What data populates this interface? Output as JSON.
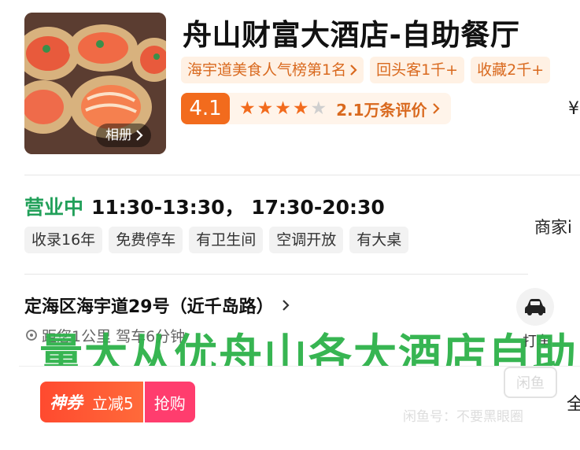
{
  "shop": {
    "title": "舟山财富大酒店-自助餐厅",
    "album_label": "相册",
    "tags": [
      "海宇道美食人气榜第1名",
      "回头客1千+",
      "收藏2千+"
    ],
    "rating": {
      "score": "4.1",
      "stars": 4,
      "max_stars": 5,
      "reviews_label": "2.1万条评价"
    },
    "price_partial": "¥"
  },
  "hours": {
    "status": "营业中",
    "text": "11:30-13:30， 17:30-20:30"
  },
  "features": [
    "收录16年",
    "免费停车",
    "有卫生间",
    "空调开放",
    "有大桌"
  ],
  "merchant_info_partial": "商家i",
  "address": {
    "text": "定海区海宇道29号（近千岛路）",
    "distance": "距您1公里 驾车6分钟"
  },
  "taxi": {
    "icon": "car-icon",
    "label": "打车"
  },
  "watermark": "量大从优舟山各大酒店自助",
  "promo": {
    "tag": "神券",
    "amount": "立减5",
    "action": "抢购",
    "right_partial": "全"
  },
  "xianyu": {
    "logo": "闲鱼",
    "text": "闲鱼号：不要黑眼圈"
  },
  "colors": {
    "accent_orange": "#f26b1d",
    "open_green": "#22a05a",
    "watermark_green": "#2fb24b",
    "coupon_red": "#ff4a2f",
    "coupon_pink": "#ff3d6e"
  }
}
